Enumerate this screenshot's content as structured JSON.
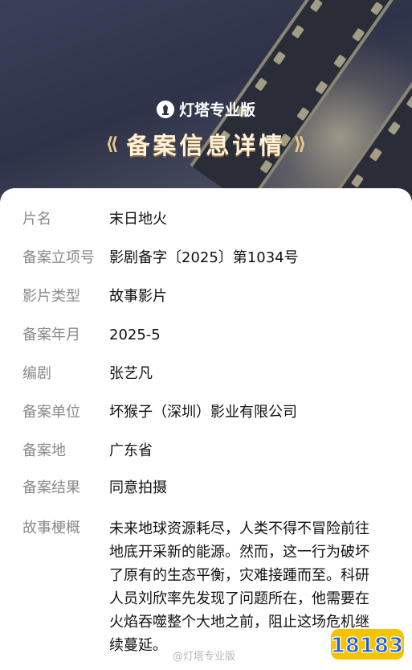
{
  "header": {
    "brand_name": "灯塔专业版",
    "title": "备案信息详情"
  },
  "details": [
    {
      "label": "片名",
      "value": "末日地火"
    },
    {
      "label": "备案立项号",
      "value": "影剧备字〔2025〕第1034号"
    },
    {
      "label": "影片类型",
      "value": "故事影片"
    },
    {
      "label": "备案年月",
      "value": "2025-5"
    },
    {
      "label": "编剧",
      "value": "张艺凡"
    },
    {
      "label": "备案单位",
      "value": "坏猴子（深圳）影业有限公司"
    },
    {
      "label": "备案地",
      "value": "广东省"
    },
    {
      "label": "备案结果",
      "value": "同意拍摄"
    }
  ],
  "synopsis": {
    "label": "故事梗概",
    "lines": [
      "未来地球资源耗尽，人类不得不冒险前往",
      "地底开采新的能源。然而，这一行为破坏",
      "了原有的生态平衡，灾难接踵而至。科研",
      "人员刘欣率先发现了问题所在，他需要在",
      "火焰吞噬整个大地之前，阻止这场危机继",
      "续蔓延。"
    ]
  },
  "watermark": "@灯塔专业版",
  "site_logo": "18183",
  "colors": {
    "header_bg": "#2f3349",
    "label": "#8a8a8a",
    "value": "#111111",
    "logo_yellow": "#f5c400",
    "logo_blue": "#1e5fd6"
  }
}
